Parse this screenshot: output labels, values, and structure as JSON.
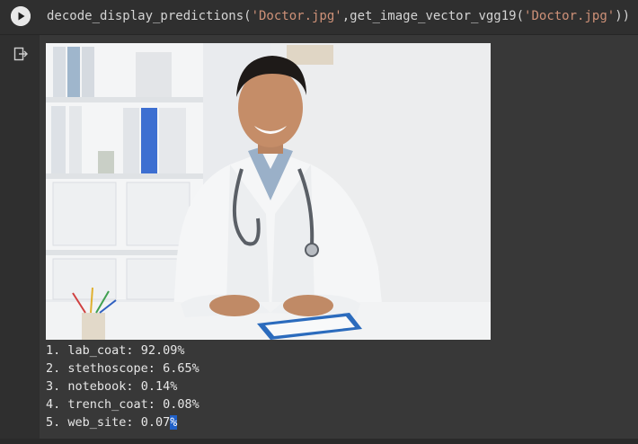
{
  "code_cell": {
    "func": "decode_display_predictions(",
    "arg1": "'Doctor.jpg'",
    "mid": ",get_image_vector_vgg19(",
    "arg2": "'Doctor.jpg'",
    "close": "))"
  },
  "icons": {
    "run": "play-circle-icon",
    "output": "output-arrow-icon"
  },
  "predictions": [
    {
      "rank": "1.",
      "label": "lab_coat:",
      "value": "92.09%"
    },
    {
      "rank": "2.",
      "label": "stethoscope:",
      "value": "6.65%"
    },
    {
      "rank": "3.",
      "label": "notebook:",
      "value": "0.14%"
    },
    {
      "rank": "4.",
      "label": "trench_coat:",
      "value": "0.08%"
    },
    {
      "rank": "5.",
      "label": "web_site:",
      "value": "0.07",
      "selected_char": "%"
    }
  ],
  "colors": {
    "code_bg": "#2f2f2f",
    "output_bg": "#383838",
    "string": "#ce9178",
    "selection": "#2060c8"
  }
}
